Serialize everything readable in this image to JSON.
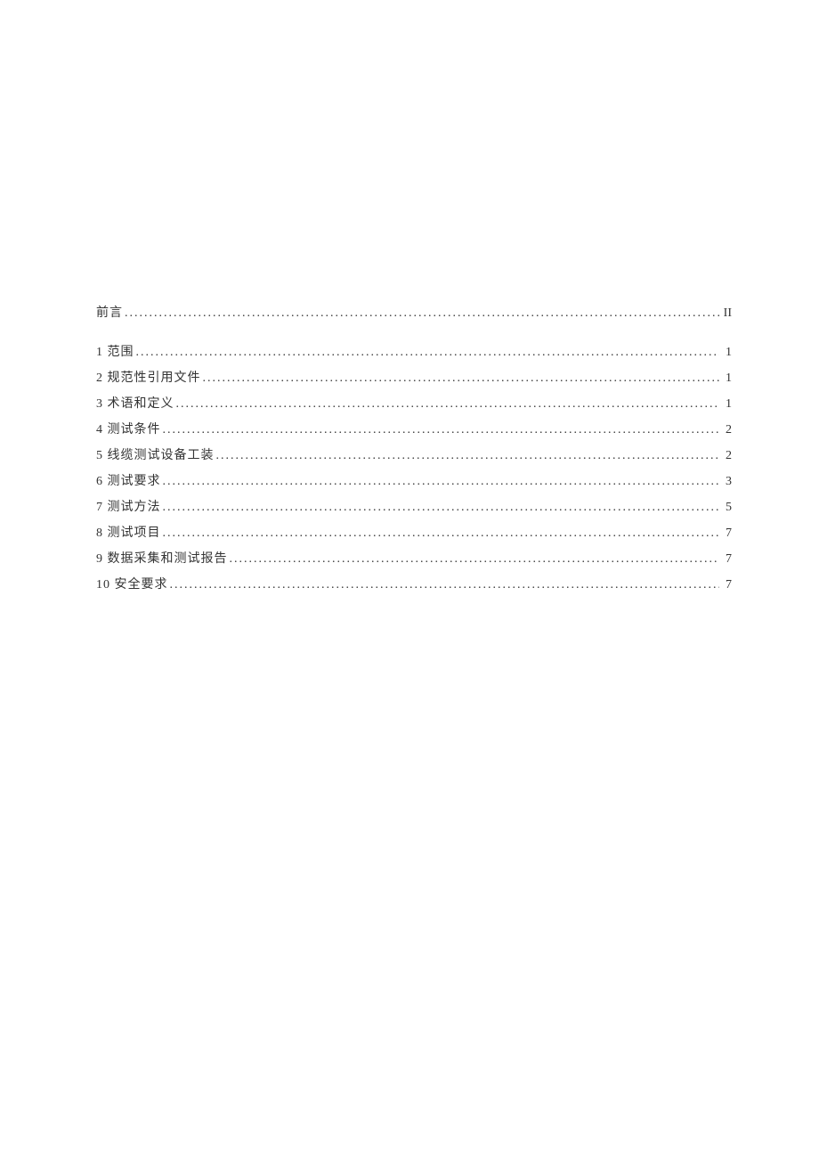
{
  "toc": {
    "entries": [
      {
        "label": "前言",
        "page": "II"
      },
      {
        "label": "1 范围",
        "page": "1"
      },
      {
        "label": "2 规范性引用文件",
        "page": "1"
      },
      {
        "label": "3 术语和定义",
        "page": "1"
      },
      {
        "label": "4 测试条件",
        "page": "2"
      },
      {
        "label": "5 线缆测试设备工装",
        "page": "2"
      },
      {
        "label": "6 测试要求",
        "page": "3"
      },
      {
        "label": "7 测试方法",
        "page": "5"
      },
      {
        "label": "8 测试项目",
        "page": "7"
      },
      {
        "label": "9 数据采集和测试报告",
        "page": "7"
      },
      {
        "label": "10 安全要求",
        "page": "7"
      }
    ]
  }
}
